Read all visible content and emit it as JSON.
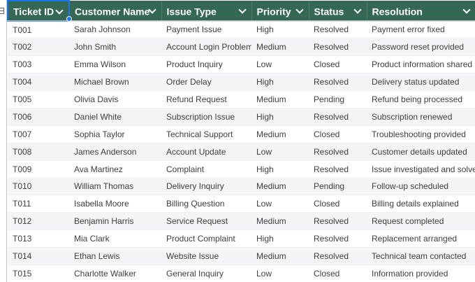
{
  "columns": [
    {
      "label": "Ticket ID"
    },
    {
      "label": "Customer Name"
    },
    {
      "label": "Issue Type"
    },
    {
      "label": "Priority"
    },
    {
      "label": "Status"
    },
    {
      "label": "Resolution"
    }
  ],
  "rows": [
    [
      "T001",
      "Sarah Johnson",
      "Payment Issue",
      "High",
      "Resolved",
      "Payment error fixed"
    ],
    [
      "T002",
      "John Smith",
      "Account Login Problem",
      "Medium",
      "Resolved",
      "Password reset provided"
    ],
    [
      "T003",
      "Emma Wilson",
      "Product Inquiry",
      "Low",
      "Closed",
      "Product information shared"
    ],
    [
      "T004",
      "Michael Brown",
      "Order Delay",
      "High",
      "Resolved",
      "Delivery status updated"
    ],
    [
      "T005",
      "Olivia Davis",
      "Refund Request",
      "Medium",
      "Pending",
      "Refund being processed"
    ],
    [
      "T006",
      "Daniel White",
      "Subscription Issue",
      "High",
      "Resolved",
      "Subscription renewed"
    ],
    [
      "T007",
      "Sophia Taylor",
      "Technical Support",
      "Medium",
      "Closed",
      "Troubleshooting provided"
    ],
    [
      "T008",
      "James Anderson",
      "Account Update",
      "Low",
      "Resolved",
      "Customer details updated"
    ],
    [
      "T009",
      "Ava Martinez",
      "Complaint",
      "High",
      "Resolved",
      "Issue investigated and solved"
    ],
    [
      "T010",
      "William Thomas",
      "Delivery Inquiry",
      "Medium",
      "Pending",
      "Follow-up scheduled"
    ],
    [
      "T011",
      "Isabella Moore",
      "Billing Question",
      "Low",
      "Closed",
      "Billing details explained"
    ],
    [
      "T012",
      "Benjamin Harris",
      "Service Request",
      "Medium",
      "Resolved",
      "Request completed"
    ],
    [
      "T013",
      "Mia Clark",
      "Product Complaint",
      "High",
      "Resolved",
      "Replacement arranged"
    ],
    [
      "T014",
      "Ethan Lewis",
      "Website Issue",
      "Medium",
      "Resolved",
      "Technical team contacted"
    ],
    [
      "T015",
      "Charlotte Walker",
      "General Inquiry",
      "Low",
      "Closed",
      "Information provided"
    ]
  ],
  "colors": {
    "header_bg": "#356854",
    "header_text": "#ffffff",
    "selection": "#1a73e8",
    "band_row": "#f4f5f6",
    "cell_text": "#3c4043"
  },
  "icons": {
    "filter": "chevron-down-icon",
    "gutter": "sheet-menu-icon"
  }
}
